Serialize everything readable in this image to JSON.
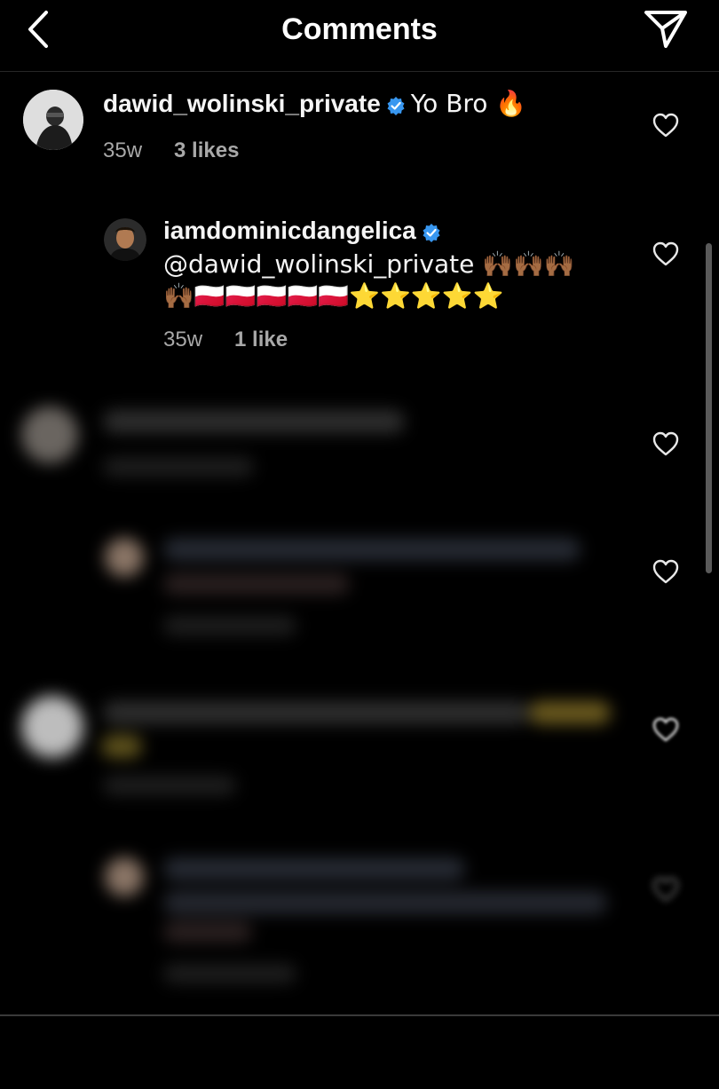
{
  "header": {
    "title": "Comments"
  },
  "comments": [
    {
      "username": "dawid_wolinski_private",
      "verified": true,
      "text": "Yo Bro 🔥",
      "time": "35w",
      "likes": "3 likes"
    },
    {
      "username": "iamdominicdangelica",
      "verified": true,
      "text_line1": "@dawid_wolinski_private 🙌🏾🙌🏾🙌🏾",
      "text_line2": "🙌🏾🇵🇱🇵🇱🇵🇱🇵🇱🇵🇱⭐⭐⭐⭐⭐",
      "time": "35w",
      "likes": "1 like"
    }
  ],
  "colors": {
    "verified_blue": "#3897f0",
    "background": "#000000",
    "meta_gray": "#a8a8a8"
  }
}
